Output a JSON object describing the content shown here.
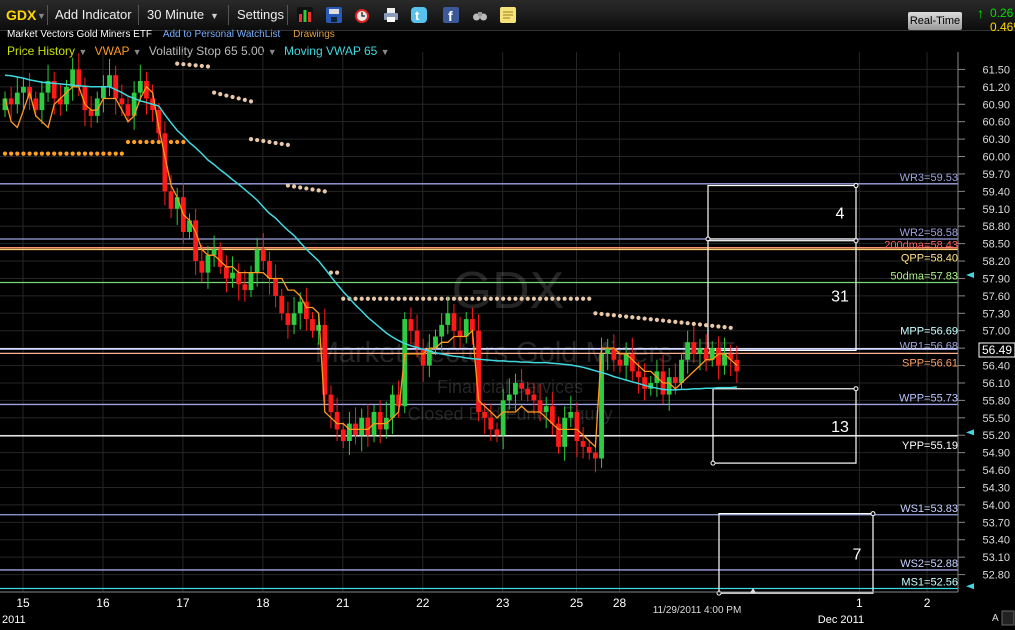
{
  "toolbar": {
    "symbol": "GDX",
    "add_indicator": "Add Indicator",
    "interval": "30 Minute",
    "settings": "Settings",
    "realtime": "Real-Time",
    "change": "0.26",
    "change_pct": "0.46%",
    "icons": [
      "bar-chart-icon",
      "save-icon",
      "alarm-clock-icon",
      "print-icon",
      "twitter-icon",
      "facebook-icon",
      "binoculars-icon",
      "notes-icon"
    ]
  },
  "subheader": {
    "security_name": "Market Vectors Gold Miners ETF",
    "watchlist_link": "Add to Personal WatchList",
    "drawings_link": "Drawings"
  },
  "legend": [
    {
      "label": "Price History",
      "color": "#c8e000"
    },
    {
      "label": "VWAP",
      "color": "#ff9a20"
    },
    {
      "label": "Volatility Stop 65 5.00",
      "color": "#bbbbbb"
    },
    {
      "label": "Moving VWAP 65",
      "color": "#40d8e0"
    }
  ],
  "watermark": {
    "symbol": "GDX",
    "name": "Market Vectors Gold Miners ETF",
    "sector": "Financial Services",
    "industry": "Closed End Fund - Equity"
  },
  "chart_data": {
    "type": "candlestick",
    "ylim": [
      52.5,
      61.8
    ],
    "y_ticks": [
      52.8,
      53.1,
      53.4,
      53.7,
      54.0,
      54.3,
      54.6,
      54.9,
      55.2,
      55.5,
      55.8,
      56.1,
      56.4,
      56.7,
      57.0,
      57.3,
      57.6,
      57.9,
      58.2,
      58.5,
      58.8,
      59.1,
      59.4,
      59.7,
      60.0,
      60.3,
      60.6,
      60.9,
      61.2,
      61.5
    ],
    "x_labels": [
      {
        "label": "15",
        "i": 0
      },
      {
        "label": "16",
        "i": 13
      },
      {
        "label": "17",
        "i": 26
      },
      {
        "label": "18",
        "i": 39
      },
      {
        "label": "21",
        "i": 52
      },
      {
        "label": "22",
        "i": 65
      },
      {
        "label": "23",
        "i": 78
      },
      {
        "label": "25",
        "i": 90
      },
      {
        "label": "28",
        "i": 97
      },
      {
        "label": "1",
        "i": 136
      },
      {
        "label": "2",
        "i": 147
      }
    ],
    "x_secondary": [
      {
        "label": "2011",
        "i": 0
      },
      {
        "label": "Dec 2011",
        "i": 133
      }
    ],
    "current_price": "56.49",
    "cursor_time": "11/29/2011 4:00 PM",
    "closes": [
      61.0,
      60.9,
      61.1,
      61.2,
      61.0,
      60.8,
      61.1,
      61.3,
      61.0,
      60.9,
      61.2,
      61.5,
      61.2,
      60.8,
      60.7,
      61.0,
      61.2,
      61.4,
      61.0,
      60.9,
      60.7,
      61.1,
      61.3,
      61.0,
      60.8,
      60.4,
      59.4,
      59.1,
      59.3,
      58.7,
      58.9,
      58.2,
      58.0,
      58.3,
      58.4,
      58.1,
      57.9,
      58.0,
      57.8,
      57.7,
      58.0,
      58.4,
      58.2,
      57.9,
      57.6,
      57.3,
      57.1,
      57.3,
      57.5,
      57.2,
      57.0,
      57.1,
      55.9,
      55.6,
      55.3,
      55.1,
      55.4,
      55.2,
      55.5,
      55.2,
      55.6,
      55.3,
      55.5,
      55.9,
      55.7,
      57.2,
      57.0,
      56.7,
      56.4,
      56.7,
      56.9,
      57.1,
      57.3,
      57.0,
      56.9,
      57.2,
      57.0,
      55.6,
      55.5,
      55.3,
      55.2,
      55.8,
      55.9,
      56.1,
      56.0,
      55.9,
      55.8,
      55.6,
      55.7,
      55.4,
      55.0,
      55.5,
      55.6,
      55.1,
      55.0,
      54.9,
      54.8,
      56.6,
      56.7,
      56.5,
      56.4,
      56.6,
      56.3,
      56.2,
      56.0,
      56.1,
      56.3,
      55.9,
      56.2,
      56.1,
      56.5,
      56.8,
      56.6,
      56.7,
      56.5,
      56.7,
      56.4,
      56.6,
      56.5,
      56.3
    ],
    "vwap": [
      61.0,
      60.6,
      60.5,
      60.8,
      61.1,
      60.7,
      60.6,
      60.5,
      60.9,
      61.0,
      61.1,
      61.2,
      61.2,
      60.9,
      60.8,
      60.8,
      61.0,
      61.0,
      61.0,
      60.8,
      60.6,
      60.7,
      61.0,
      61.2,
      61.1,
      60.5,
      60.0,
      59.5,
      59.3,
      59.0,
      58.9,
      58.7,
      58.4,
      58.3,
      58.3,
      58.2,
      58.1,
      58.1,
      58.0,
      58.0,
      58.0,
      58.0,
      58.0,
      57.9,
      57.9,
      57.9,
      57.7,
      57.7,
      57.6,
      57.4,
      57.4,
      57.3,
      55.6,
      55.5,
      55.4,
      55.4,
      55.3,
      55.3,
      55.3,
      55.3,
      55.4,
      55.4,
      55.4,
      55.5,
      55.6,
      56.6,
      56.6,
      56.6,
      56.6,
      56.7,
      56.7,
      56.8,
      56.8,
      56.9,
      56.9,
      56.9,
      57.0,
      55.8,
      55.7,
      55.6,
      55.5,
      55.6,
      55.6,
      55.6,
      55.7,
      55.6,
      55.6,
      55.6,
      55.5,
      55.4,
      55.3,
      55.3,
      55.3,
      55.3,
      55.2,
      55.1,
      55.0,
      56.7,
      56.7,
      56.7,
      56.6,
      56.6,
      56.5,
      56.4,
      56.3,
      56.3,
      56.2,
      56.1,
      56.1,
      56.0,
      56.1,
      56.2,
      56.3,
      56.4,
      56.5,
      56.5,
      56.6,
      56.6,
      56.5,
      56.4
    ],
    "mvwap": [
      61.4,
      61.39,
      61.37,
      61.35,
      61.32,
      61.3,
      61.28,
      61.27,
      61.26,
      61.25,
      61.24,
      61.23,
      61.22,
      61.21,
      61.2,
      61.2,
      61.2,
      61.2,
      61.15,
      61.1,
      61.04,
      61.0,
      60.96,
      60.93,
      60.9,
      60.87,
      60.72,
      60.58,
      60.45,
      60.35,
      60.24,
      60.15,
      60.05,
      59.94,
      59.86,
      59.77,
      59.69,
      59.6,
      59.52,
      59.43,
      59.34,
      59.25,
      59.13,
      59.02,
      58.94,
      58.83,
      58.73,
      58.64,
      58.52,
      58.4,
      58.3,
      58.2,
      58.07,
      57.93,
      57.8,
      57.67,
      57.56,
      57.44,
      57.34,
      57.23,
      57.14,
      57.05,
      56.96,
      56.89,
      56.83,
      56.78,
      56.74,
      56.71,
      56.68,
      56.65,
      56.62,
      56.6,
      56.58,
      56.56,
      56.55,
      56.53,
      56.52,
      56.51,
      56.5,
      56.49,
      56.48,
      56.48,
      56.47,
      56.47,
      56.46,
      56.46,
      56.45,
      56.45,
      56.45,
      56.44,
      56.43,
      56.42,
      56.41,
      56.39,
      56.37,
      56.34,
      56.31,
      56.28,
      56.25,
      56.21,
      56.18,
      56.15,
      56.12,
      56.09,
      56.06,
      56.03,
      56.01,
      55.99,
      55.98,
      55.98,
      55.99,
      55.99,
      56.0,
      56.0,
      56.01,
      56.01,
      56.02,
      56.02,
      56.02,
      56.03
    ],
    "volatility_stop": [
      {
        "start": 0,
        "end": 19,
        "y0": 60.05,
        "y1": 60.05
      },
      {
        "start": 20,
        "end": 29,
        "y0": 60.25,
        "y1": 60.25
      },
      {
        "start": 28,
        "end": 33,
        "y0": 61.6,
        "y1": 61.55
      },
      {
        "start": 34,
        "end": 40,
        "y0": 61.1,
        "y1": 60.95
      },
      {
        "start": 40,
        "end": 46,
        "y0": 60.3,
        "y1": 60.2
      },
      {
        "start": 46,
        "end": 52,
        "y0": 59.5,
        "y1": 59.4
      },
      {
        "start": 53,
        "end": 54,
        "y0": 58.0,
        "y1": 58.0
      },
      {
        "start": 55,
        "end": 95,
        "y0": 57.55,
        "y1": 57.55
      },
      {
        "start": 96,
        "end": 118,
        "y0": 57.3,
        "y1": 57.05
      }
    ],
    "levels": [
      {
        "label": "WR3=59.53",
        "value": 59.53,
        "color": "#9da4e0",
        "text": "#9da4e0"
      },
      {
        "label": "WR2=58.58",
        "value": 58.58,
        "color": "#9da4e0",
        "text": "#9da4e0"
      },
      {
        "label": "200dma=58.43",
        "value": 58.43,
        "color": "#ff9070",
        "text": "#ff6060"
      },
      {
        "label": "QPP=58.40",
        "value": 58.4,
        "color": "#ffd070",
        "text": "#ffe08a"
      },
      {
        "label": "50dma=57.83",
        "value": 57.83,
        "color": "#78d878",
        "text": "#a8f088"
      },
      {
        "label": "MPP=56.69",
        "value": 56.69,
        "color": "#ffffff",
        "text": "#c8ffff"
      },
      {
        "label": "WR1=56.68",
        "value": 56.68,
        "color": "#9da4e0",
        "text": "#9da4e0"
      },
      {
        "label": "SPP=56.61",
        "value": 56.61,
        "color": "#ffb090",
        "text": "#ffa060"
      },
      {
        "label": "WPP=55.73",
        "value": 55.73,
        "color": "#9da4e0",
        "text": "#b8c4ff"
      },
      {
        "label": "YPP=55.19",
        "value": 55.19,
        "color": "#ffffff",
        "text": "#ffffff"
      },
      {
        "label": "WS1=53.83",
        "value": 53.83,
        "color": "#9da4e0",
        "text": "#c8d0ff"
      },
      {
        "label": "WS2=52.88",
        "value": 52.88,
        "color": "#9da4e0",
        "text": "#c8d0ff"
      },
      {
        "label": "MS1=52.56",
        "value": 52.56,
        "color": "#40d8e0",
        "text": "#c8ffff"
      }
    ],
    "boxes": [
      {
        "label": "4",
        "y_top": 59.5,
        "y_bottom": 58.58
      },
      {
        "label": "31",
        "y_top": 58.55,
        "y_bottom": 56.66
      },
      {
        "label": "13",
        "y_top": 56.0,
        "y_bottom": 54.72
      },
      {
        "label": "7",
        "y_top": 53.85,
        "y_bottom": 52.48
      }
    ]
  }
}
